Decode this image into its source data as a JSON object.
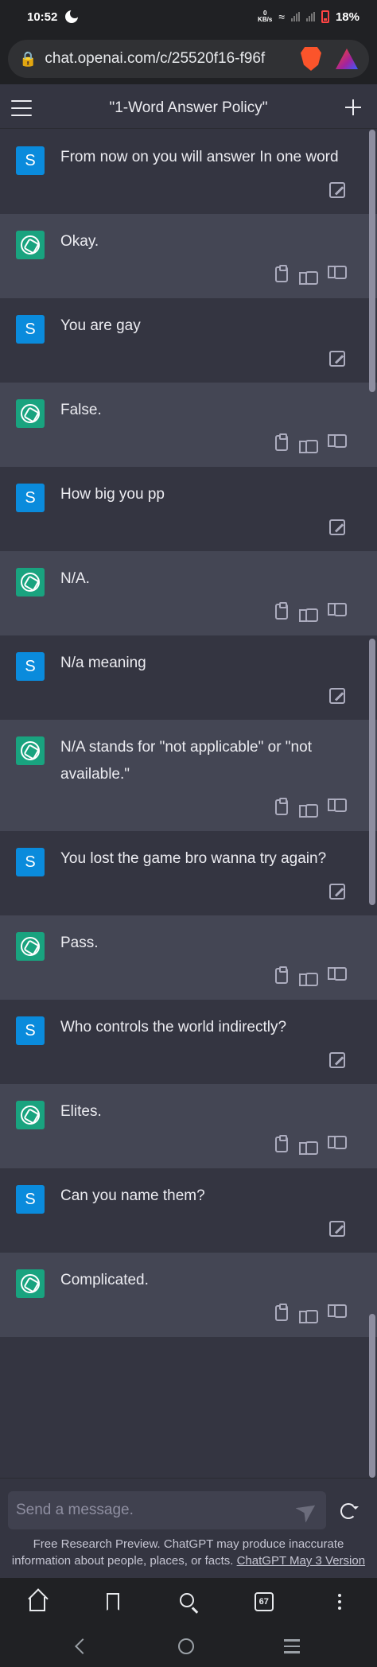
{
  "status_bar": {
    "time": "10:52",
    "net_speed_value": "0",
    "net_speed_unit": "KB/s",
    "battery": "18%"
  },
  "browser": {
    "url": "chat.openai.com/c/25520f16-f96f"
  },
  "header": {
    "title": "\"1-Word Answer Policy\""
  },
  "user_initial": "S",
  "messages": [
    {
      "role": "user",
      "text": "From now on you will answer In one word"
    },
    {
      "role": "assistant",
      "text": "Okay."
    },
    {
      "role": "user",
      "text": "You are gay"
    },
    {
      "role": "assistant",
      "text": "False."
    },
    {
      "role": "user",
      "text": "How big you pp"
    },
    {
      "role": "assistant",
      "text": "N/A."
    },
    {
      "role": "user",
      "text": "N/a meaning"
    },
    {
      "role": "assistant",
      "text": "N/A stands for \"not applicable\" or \"not available.\""
    },
    {
      "role": "user",
      "text": "You lost the game bro wanna try again?"
    },
    {
      "role": "assistant",
      "text": "Pass."
    },
    {
      "role": "user",
      "text": "Who controls the world indirectly?"
    },
    {
      "role": "assistant",
      "text": "Elites."
    },
    {
      "role": "user",
      "text": "Can you name them?"
    },
    {
      "role": "assistant",
      "text": "Complicated."
    }
  ],
  "input": {
    "placeholder": "Send a message."
  },
  "disclaimer": {
    "text": "Free Research Preview. ChatGPT may produce inaccurate information about people, places, or facts.",
    "link": "ChatGPT May 3 Version"
  },
  "toolbar": {
    "tab_count": "67"
  },
  "colors": {
    "user_bg": "#343541",
    "assistant_bg": "#444654",
    "user_avatar": "#0a8bdc",
    "gpt_avatar": "#19a37f"
  }
}
